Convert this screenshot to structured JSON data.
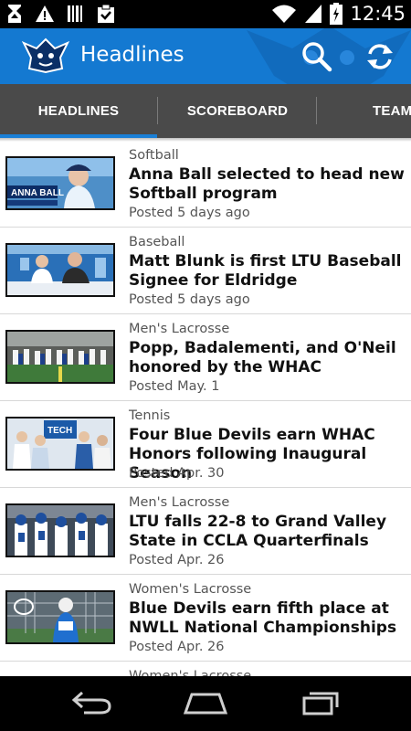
{
  "status_bar": {
    "time": "12:45",
    "icons_left": [
      "usb-icon",
      "warning-icon",
      "barcode-icon",
      "clipboard-check-icon"
    ],
    "icons_right": [
      "wifi-icon",
      "signal-icon",
      "battery-icon"
    ]
  },
  "app_bar": {
    "title": "Headlines",
    "logo": "blue-devil-logo",
    "actions": [
      "search-icon",
      "refresh-icon"
    ]
  },
  "tabs": [
    {
      "label": "HEADLINES",
      "selected": true
    },
    {
      "label": "SCOREBOARD",
      "selected": false
    },
    {
      "label": "TEAM",
      "selected": false
    }
  ],
  "colors": {
    "app_bar": "#1479d1",
    "tab_bar": "#4a4a4a",
    "tab_indicator": "#1a7fd6"
  },
  "headlines": [
    {
      "category": "Softball",
      "title": "Anna Ball selected to head new Softball program",
      "date": "Posted 5 days ago",
      "thumb_caption": "ANNA BALL"
    },
    {
      "category": "Baseball",
      "title": "Matt Blunk is first LTU Baseball Signee for Eldridge",
      "date": "Posted 5 days ago"
    },
    {
      "category": "Men's Lacrosse",
      "title": "Popp, Badalementi, and O'Neil honored by the WHAC",
      "date": "Posted May. 1"
    },
    {
      "category": "Tennis",
      "title": "Four Blue Devils earn WHAC Honors following Inaugural Season",
      "date": "Posted Apr. 30",
      "thumb_caption": "TECH"
    },
    {
      "category": "Men's Lacrosse",
      "title": "LTU falls 22-8 to Grand Valley State in CCLA Quarterfinals",
      "date": "Posted Apr. 26"
    },
    {
      "category": "Women's Lacrosse",
      "title": "Blue Devils earn fifth place at NWLL National Championships",
      "date": "Posted Apr. 26"
    },
    {
      "category": "Women's Lacrosse"
    }
  ],
  "nav_bar": [
    "back-icon",
    "home-icon",
    "recents-icon"
  ]
}
